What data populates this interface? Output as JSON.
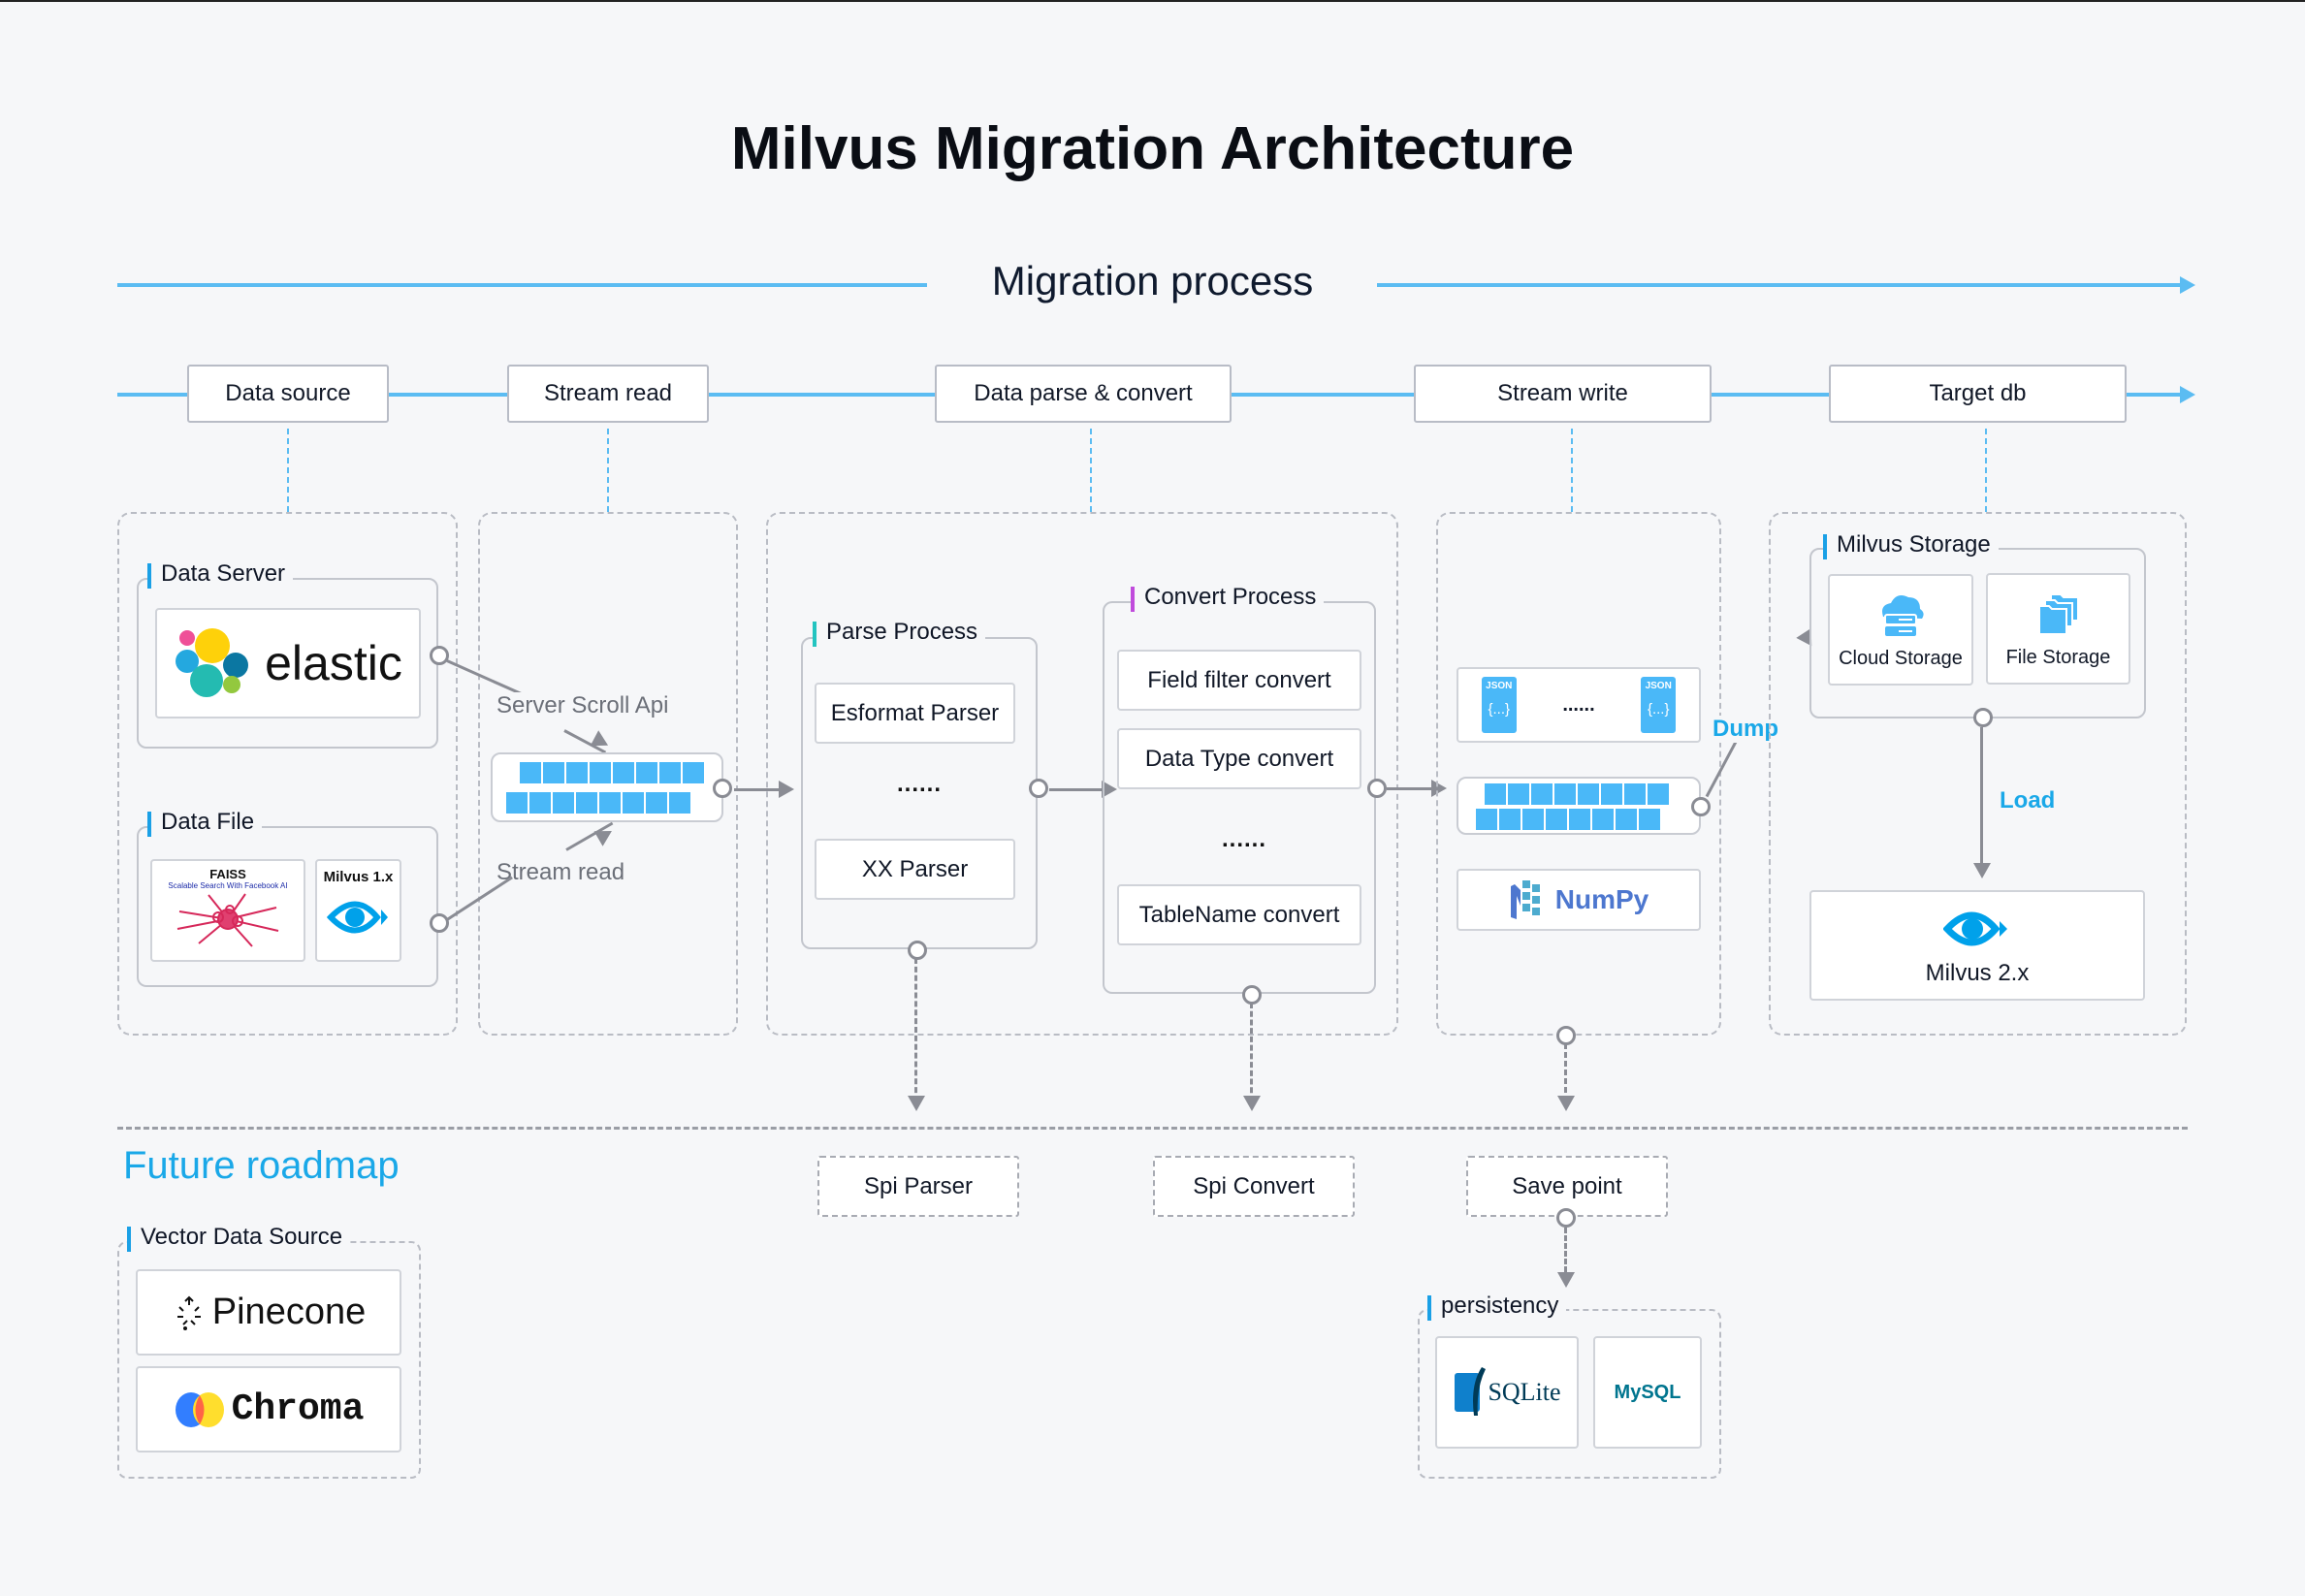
{
  "title": "Milvus Migration Architecture",
  "subtitle": "Migration process",
  "stages": [
    {
      "label": "Data source"
    },
    {
      "label": "Stream read"
    },
    {
      "label": "Data parse & convert"
    },
    {
      "label": "Stream write"
    },
    {
      "label": "Target db"
    }
  ],
  "data_source": {
    "data_server": {
      "label": "Data Server",
      "logo": "elastic"
    },
    "data_file": {
      "label": "Data File",
      "faiss": {
        "name": "FAISS",
        "tagline": "Scalable Search With Facebook AI"
      },
      "milvus1": {
        "name": "Milvus 1.x"
      }
    }
  },
  "stream_read": {
    "server_scroll_label": "Server Scroll Api",
    "stream_read_label": "Stream read"
  },
  "parse_convert": {
    "parse_process": {
      "label": "Parse Process",
      "items": [
        "Esformat Parser",
        "......",
        "XX Parser"
      ]
    },
    "convert_process": {
      "label": "Convert Process",
      "items": [
        "Field filter convert",
        "Data Type convert",
        "......",
        "TableName convert"
      ]
    }
  },
  "stream_write": {
    "json_label": "JSON",
    "json_body": "{...}",
    "ellipsis": "......",
    "numpy": "NumPy",
    "dump_label": "Dump"
  },
  "target_db": {
    "milvus_storage": {
      "label": "Milvus Storage",
      "cloud": "Cloud Storage",
      "file": "File Storage"
    },
    "load_label": "Load",
    "milvus2": "Milvus 2.x"
  },
  "roadmap": {
    "title": "Future roadmap",
    "vector_data_source": {
      "label": "Vector Data Source",
      "items": [
        "Pinecone",
        "Chroma"
      ]
    },
    "spi_parser": "Spi Parser",
    "spi_convert": "Spi Convert",
    "save_point": "Save point",
    "persistency": {
      "label": "persistency",
      "items": [
        "SQLite",
        "MySQL"
      ]
    }
  },
  "colors": {
    "accent_blue": "#1aa8e8",
    "timeline_blue": "#5bbcf2",
    "cell_blue": "#4ab8f8",
    "connector_grey": "#8a8c94",
    "convert_accent": "#c04bdc",
    "parse_accent": "#23c4c0"
  }
}
